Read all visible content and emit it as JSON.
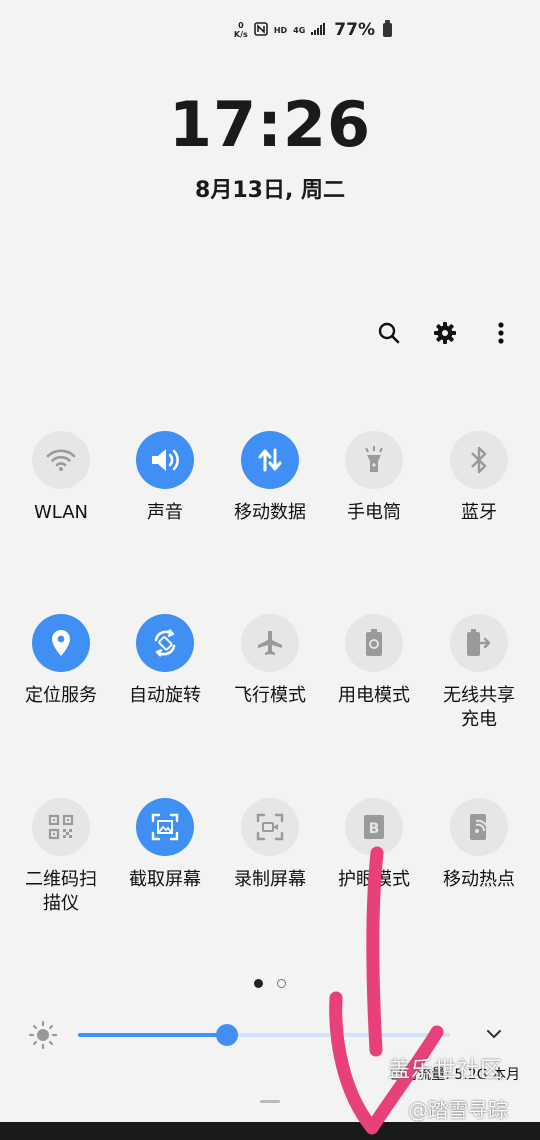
{
  "status": {
    "net_top": "0",
    "net_bottom": "K/s",
    "hd": "HD",
    "net_type": "4G",
    "battery_pct": "77%"
  },
  "lock": {
    "time": "17:26",
    "date": "8月13日, 周二"
  },
  "tiles": [
    {
      "label": "WLAN",
      "icon": "wifi-icon",
      "on": false
    },
    {
      "label": "声音",
      "icon": "sound-icon",
      "on": true
    },
    {
      "label": "移动数据",
      "icon": "mobile-data-icon",
      "on": true
    },
    {
      "label": "手电筒",
      "icon": "flashlight-icon",
      "on": false
    },
    {
      "label": "蓝牙",
      "icon": "bluetooth-icon",
      "on": false
    },
    {
      "label": "定位服务",
      "icon": "location-icon",
      "on": true
    },
    {
      "label": "自动旋转",
      "icon": "auto-rotate-icon",
      "on": true
    },
    {
      "label": "飞行模式",
      "icon": "airplane-icon",
      "on": false
    },
    {
      "label": "用电模式",
      "icon": "power-mode-icon",
      "on": false
    },
    {
      "label": "无线共享\n充电",
      "icon": "wireless-share-icon",
      "on": false
    },
    {
      "label": "二维码扫\n描仪",
      "icon": "qr-icon",
      "on": false
    },
    {
      "label": "截取屏幕",
      "icon": "screenshot-icon",
      "on": true
    },
    {
      "label": "录制屏幕",
      "icon": "screen-record-icon",
      "on": false
    },
    {
      "label": "护眼模式",
      "icon": "eye-comfort-icon",
      "on": false
    },
    {
      "label": "移动热点",
      "icon": "hotspot-icon",
      "on": false
    }
  ],
  "brightness": {
    "level": 0.4
  },
  "usage": "已用流量: 5.2G 本月",
  "watermark": {
    "line1": "盖乐世社区",
    "line2": "@踏雪寻踪"
  },
  "colors": {
    "accent": "#3f8ff5",
    "off": "#e6e6e6",
    "scribble": "#e8407a"
  }
}
